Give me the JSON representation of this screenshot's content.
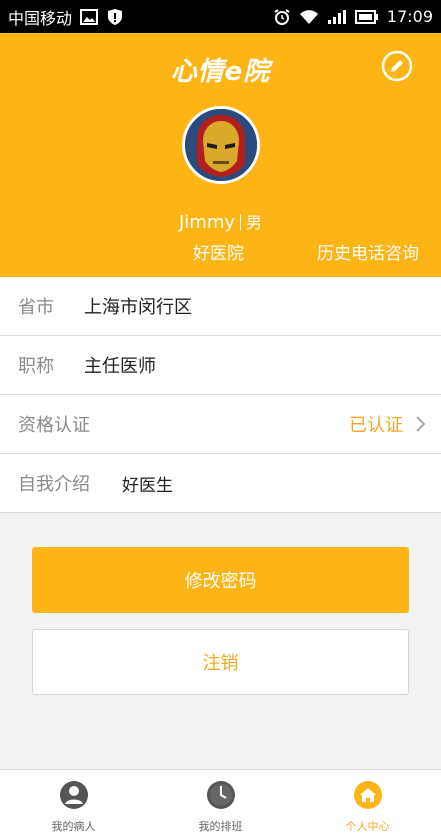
{
  "status_bar": {
    "carrier": "中国移动",
    "time": "17:09",
    "icons": [
      "image-icon",
      "shield-alert-icon",
      "alarm-icon",
      "wifi-icon",
      "signal-icon",
      "battery-icon"
    ]
  },
  "header": {
    "logo_text": "心情e院",
    "edit_icon": "edit-icon",
    "name": "Jimmy",
    "gender": "男",
    "hospital": "好医院",
    "history_link": "历史电话咨询"
  },
  "info": {
    "province": {
      "label": "省市",
      "value": "上海市闵行区"
    },
    "title": {
      "label": "职称",
      "value": "主任医师"
    },
    "qualification": {
      "label": "资格认证",
      "status": "已认证"
    },
    "intro": {
      "label": "自我介绍",
      "value": "好医生"
    }
  },
  "buttons": {
    "change_password": "修改密码",
    "logout": "注销"
  },
  "tabs": [
    {
      "label": "我的病人",
      "icon": "user-icon",
      "active": false
    },
    {
      "label": "我的排班",
      "icon": "clock-icon",
      "active": false
    },
    {
      "label": "个人中心",
      "icon": "home-icon",
      "active": true
    }
  ],
  "colors": {
    "accent": "#fdb515",
    "accent_text": "#f5a623",
    "status_bar": "#000000",
    "background": "#f2f2f2"
  }
}
